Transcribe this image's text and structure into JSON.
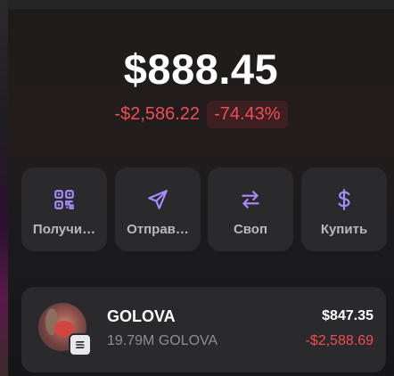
{
  "balance": {
    "total": "$888.45",
    "change_value": "-$2,586.22",
    "change_percent": "-74.43%"
  },
  "colors": {
    "accent": "#a78bfa",
    "negative": "#ef4f54",
    "card": "#2a2a2c"
  },
  "actions": [
    {
      "label": "Получи…",
      "icon": "qr-code-icon"
    },
    {
      "label": "Отправ…",
      "icon": "send-icon"
    },
    {
      "label": "Своп",
      "icon": "swap-icon"
    },
    {
      "label": "Купить",
      "icon": "dollar-icon"
    }
  ],
  "tokens": [
    {
      "name": "GOLOVA",
      "amount": "19.79M GOLOVA",
      "value": "$847.35",
      "change": "-$2,588.69",
      "chain_icon": "solana-icon"
    }
  ]
}
